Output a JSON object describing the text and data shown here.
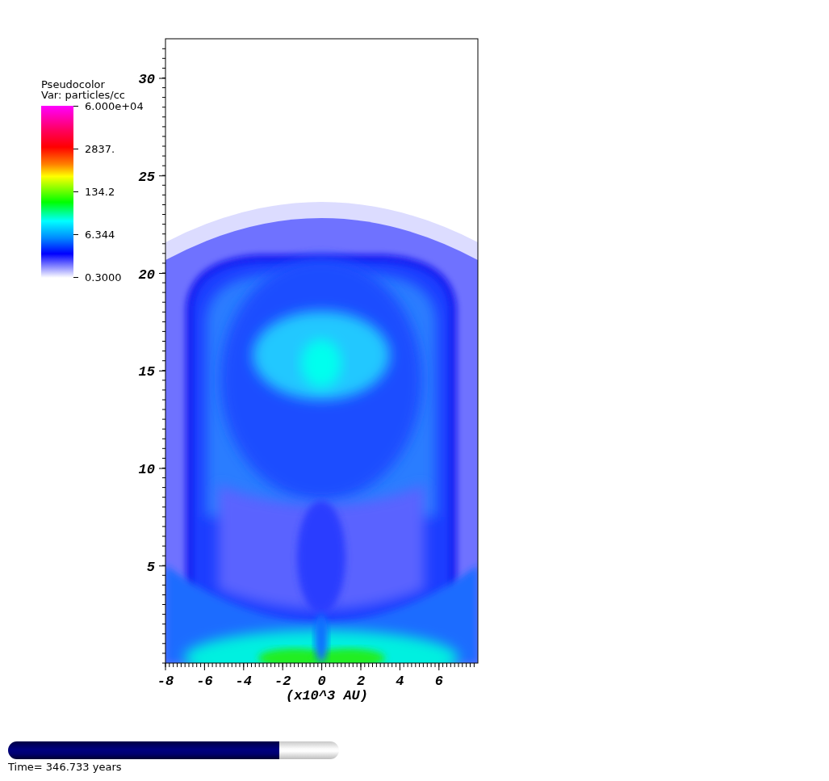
{
  "legend": {
    "title": "Pseudocolor",
    "variable": "Var: particles/cc",
    "labels": [
      "6.000e+04",
      "2837.",
      "134.2",
      "6.344",
      "0.3000"
    ]
  },
  "plot": {
    "y_ticks": [
      "30",
      "25",
      "20",
      "15",
      "10",
      "5"
    ],
    "x_ticks": [
      "-8",
      "-6",
      "-4",
      "-2",
      "0",
      "2",
      "4",
      "6"
    ],
    "x_label": "(x10^3 AU)"
  },
  "time_slider": {
    "level": 0.82,
    "label": "Time= 346.733 years"
  }
}
